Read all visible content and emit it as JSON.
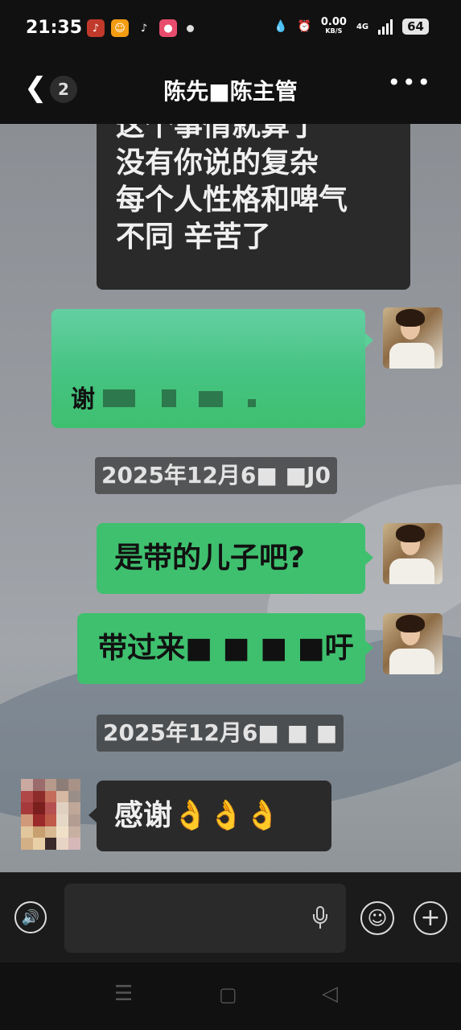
{
  "status_bar": {
    "time": "21:35",
    "net_speed_value": "0.00",
    "net_speed_unit": "KB/S",
    "network": "4G",
    "battery": "64"
  },
  "nav": {
    "unread_count": "2",
    "title": "陈先■陈主管"
  },
  "messages": {
    "m1_lines": [
      "这个事情就算了",
      "没有你说的复杂",
      "每个人性格和啤气",
      "不同  辛苦了"
    ],
    "m2_visible_text": "谢",
    "time1": "2025年12月6■ ■J0",
    "m3": "是带的儿子吧?",
    "m4": "带过来■ ■ ■ ■吁",
    "time2": "2025年12月6■ ■ ■",
    "m5": "感谢👌👌👌"
  },
  "input": {
    "placeholder": ""
  },
  "colors": {
    "sent_bubble": "#3fc06e",
    "received_bubble": "#2a2a2a",
    "chat_background": "#979ba0"
  }
}
